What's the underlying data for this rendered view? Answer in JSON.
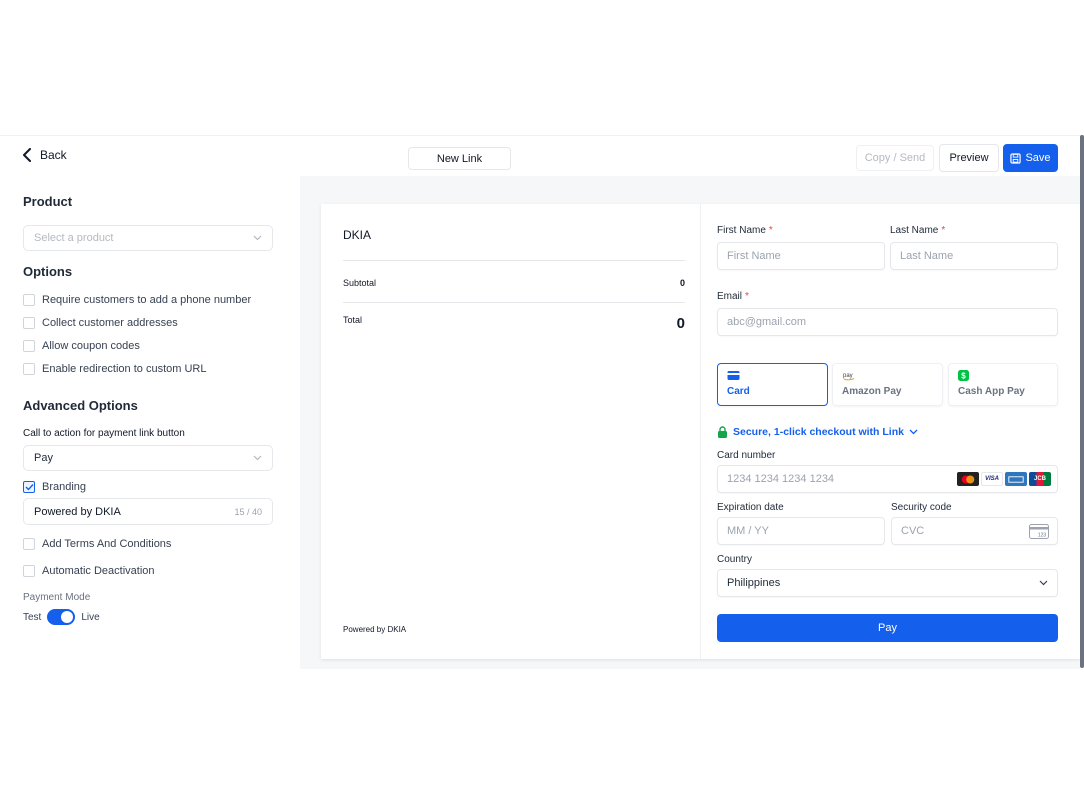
{
  "topbar": {
    "back_label": "Back",
    "link_name": "New Link",
    "copy_send_label": "Copy / Send",
    "preview_label": "Preview",
    "save_label": "Save"
  },
  "left": {
    "product_heading": "Product",
    "product_placeholder": "Select a product",
    "options_heading": "Options",
    "options": [
      {
        "label": "Require customers to add a phone number",
        "checked": false
      },
      {
        "label": "Collect customer addresses",
        "checked": false
      },
      {
        "label": "Allow coupon codes",
        "checked": false
      },
      {
        "label": "Enable redirection to custom URL",
        "checked": false
      }
    ],
    "advanced_heading": "Advanced Options",
    "cta_label": "Call to action for payment link button",
    "cta_value": "Pay",
    "branding_label": "Branding",
    "branding_checked": true,
    "branding_value": "Powered by DKIA",
    "branding_count": "15 / 40",
    "terms_label": "Add Terms And Conditions",
    "deactivation_label": "Automatic Deactivation",
    "payment_mode_label": "Payment Mode",
    "mode_test": "Test",
    "mode_live": "Live",
    "mode_is_live": true
  },
  "preview": {
    "merchant_name": "DKIA",
    "subtotal_label": "Subtotal",
    "subtotal_value": "0",
    "total_label": "Total",
    "total_value": "0",
    "powered_by": "Powered by DKIA",
    "first_name_label": "First Name",
    "first_name_placeholder": "First Name",
    "last_name_label": "Last Name",
    "last_name_placeholder": "Last Name",
    "required_mark": "*",
    "email_label": "Email",
    "email_placeholder": "abc@gmail.com",
    "payment_methods": [
      {
        "label": "Card",
        "icon": "card-icon",
        "active": true
      },
      {
        "label": "Amazon Pay",
        "icon": "amazon-pay-icon",
        "active": false
      },
      {
        "label": "Cash App Pay",
        "icon": "cash-app-icon",
        "active": false
      }
    ],
    "amazon_icon_text": "pay",
    "secure_text": "Secure, 1-click checkout with Link",
    "card_number_label": "Card number",
    "card_number_placeholder": "1234 1234 1234 1234",
    "card_brands": [
      "mastercard-icon",
      "visa-icon",
      "amex-icon",
      "jcb-icon"
    ],
    "visa_text": "VISA",
    "jcb_text": "JCB",
    "expiry_label": "Expiration date",
    "expiry_placeholder": "MM / YY",
    "security_label": "Security code",
    "security_placeholder": "CVC",
    "cvc_icon_text": "123",
    "country_label": "Country",
    "country_value": "Philippines",
    "pay_button": "Pay"
  },
  "colors": {
    "primary": "#1460ec",
    "required": "#e5484d",
    "secure_lock": "#16a34a",
    "cash_app": "#00c244",
    "mastercard_red": "#eb001b",
    "mastercard_orange": "#f79e1b",
    "visa_blue": "#1a1f71"
  }
}
